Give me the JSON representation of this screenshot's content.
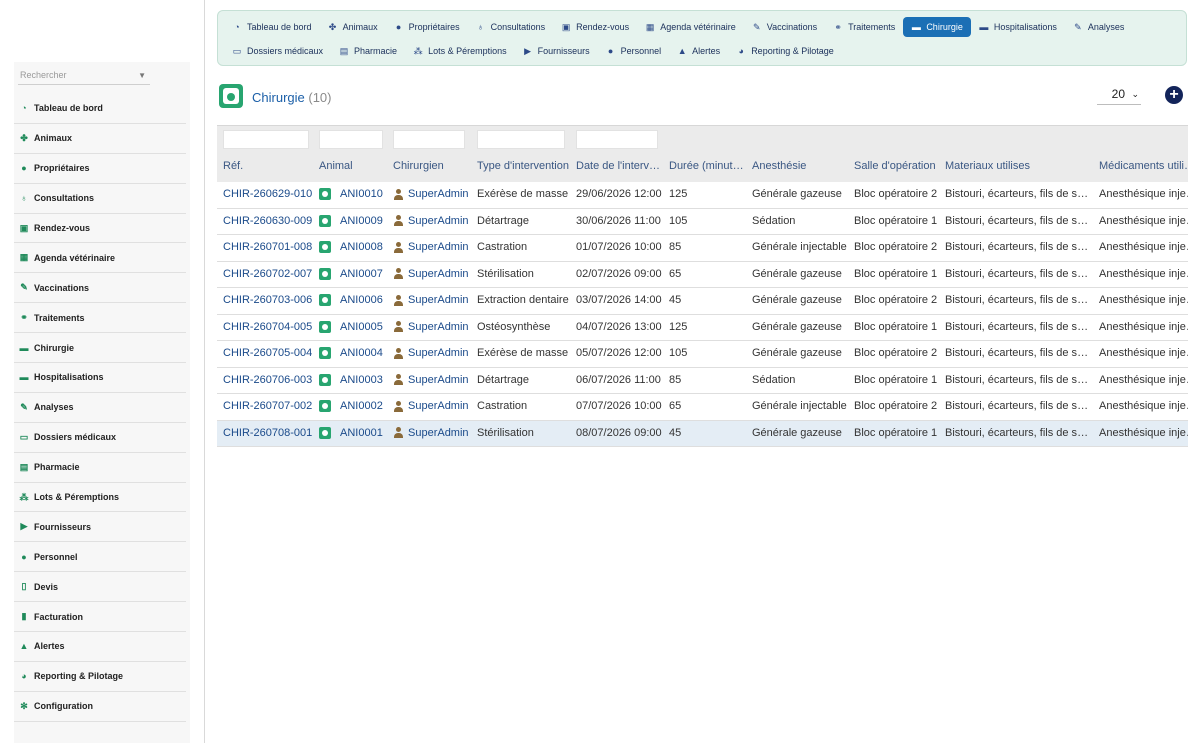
{
  "sidebar": {
    "search_placeholder": "Rechercher",
    "items": [
      {
        "label": "Tableau de bord",
        "icon": "dashboard-icon"
      },
      {
        "label": "Animaux",
        "icon": "paw-icon"
      },
      {
        "label": "Propriétaires",
        "icon": "user-icon"
      },
      {
        "label": "Consultations",
        "icon": "stethoscope-icon"
      },
      {
        "label": "Rendez-vous",
        "icon": "calendar-check-icon"
      },
      {
        "label": "Agenda vétérinaire",
        "icon": "calendar-icon"
      },
      {
        "label": "Vaccinations",
        "icon": "syringe-icon"
      },
      {
        "label": "Traitements",
        "icon": "pills-icon"
      },
      {
        "label": "Chirurgie",
        "icon": "bed-icon"
      },
      {
        "label": "Hospitalisations",
        "icon": "hospital-bed-icon"
      },
      {
        "label": "Analyses",
        "icon": "flask-icon"
      },
      {
        "label": "Dossiers médicaux",
        "icon": "folder-icon"
      },
      {
        "label": "Pharmacie",
        "icon": "medkit-icon"
      },
      {
        "label": "Lots & Péremptions",
        "icon": "sitemap-icon"
      },
      {
        "label": "Fournisseurs",
        "icon": "truck-icon"
      },
      {
        "label": "Personnel",
        "icon": "user-icon"
      },
      {
        "label": "Devis",
        "icon": "file-icon"
      },
      {
        "label": "Facturation",
        "icon": "invoice-icon"
      },
      {
        "label": "Alertes",
        "icon": "warning-icon"
      },
      {
        "label": "Reporting & Pilotage",
        "icon": "pie-chart-icon"
      },
      {
        "label": "Configuration",
        "icon": "gear-icon"
      }
    ]
  },
  "topnav": {
    "row1": [
      {
        "label": "Tableau de bord",
        "icon": "dashboard-icon"
      },
      {
        "label": "Animaux",
        "icon": "paw-icon"
      },
      {
        "label": "Propriétaires",
        "icon": "user-icon"
      },
      {
        "label": "Consultations",
        "icon": "stethoscope-icon"
      },
      {
        "label": "Rendez-vous",
        "icon": "calendar-check-icon"
      },
      {
        "label": "Agenda vétérinaire",
        "icon": "calendar-icon"
      },
      {
        "label": "Vaccinations",
        "icon": "syringe-icon"
      },
      {
        "label": "Traitements",
        "icon": "pills-icon"
      },
      {
        "label": "Chirurgie",
        "icon": "bed-icon",
        "active": true
      },
      {
        "label": "Hospitalisations",
        "icon": "hospital-bed-icon"
      },
      {
        "label": "Analyses",
        "icon": "flask-icon"
      }
    ],
    "row2": [
      {
        "label": "Dossiers médicaux",
        "icon": "folder-icon"
      },
      {
        "label": "Pharmacie",
        "icon": "medkit-icon"
      },
      {
        "label": "Lots & Péremptions",
        "icon": "sitemap-icon"
      },
      {
        "label": "Fournisseurs",
        "icon": "truck-icon"
      },
      {
        "label": "Personnel",
        "icon": "user-icon"
      },
      {
        "label": "Alertes",
        "icon": "warning-icon"
      },
      {
        "label": "Reporting & Pilotage",
        "icon": "pie-chart-icon"
      }
    ]
  },
  "page": {
    "title": "Chirurgie",
    "count": "(10)",
    "per_page": "20"
  },
  "table": {
    "headers": [
      "Réf.",
      "Animal",
      "Chirurgien",
      "Type d'intervention",
      "Date de l'intervention",
      "Durée (minutes)",
      "Anesthésie",
      "Salle d'opération",
      "Materiaux utilises",
      "Médicaments utilisés"
    ],
    "rows": [
      [
        "CHIR-260629-010",
        "ANI0010",
        "SuperAdmin",
        "Exérèse de masse",
        "29/06/2026 12:00",
        "125",
        "Générale gazeuse",
        "Bloc opératoire 2",
        "Bistouri, écarteurs, fils de suture",
        "Anesthésique injectable"
      ],
      [
        "CHIR-260630-009",
        "ANI0009",
        "SuperAdmin",
        "Détartrage",
        "30/06/2026 11:00",
        "105",
        "Sédation",
        "Bloc opératoire 1",
        "Bistouri, écarteurs, fils de suture",
        "Anesthésique injectable"
      ],
      [
        "CHIR-260701-008",
        "ANI0008",
        "SuperAdmin",
        "Castration",
        "01/07/2026 10:00",
        "85",
        "Générale injectable",
        "Bloc opératoire 2",
        "Bistouri, écarteurs, fils de suture",
        "Anesthésique injectable"
      ],
      [
        "CHIR-260702-007",
        "ANI0007",
        "SuperAdmin",
        "Stérilisation",
        "02/07/2026 09:00",
        "65",
        "Générale gazeuse",
        "Bloc opératoire 1",
        "Bistouri, écarteurs, fils de suture",
        "Anesthésique injectable"
      ],
      [
        "CHIR-260703-006",
        "ANI0006",
        "SuperAdmin",
        "Extraction dentaire",
        "03/07/2026 14:00",
        "45",
        "Générale gazeuse",
        "Bloc opératoire 2",
        "Bistouri, écarteurs, fils de suture",
        "Anesthésique injectable"
      ],
      [
        "CHIR-260704-005",
        "ANI0005",
        "SuperAdmin",
        "Ostéosynthèse",
        "04/07/2026 13:00",
        "125",
        "Générale gazeuse",
        "Bloc opératoire 1",
        "Bistouri, écarteurs, fils de suture",
        "Anesthésique injectable"
      ],
      [
        "CHIR-260705-004",
        "ANI0004",
        "SuperAdmin",
        "Exérèse de masse",
        "05/07/2026 12:00",
        "105",
        "Générale gazeuse",
        "Bloc opératoire 2",
        "Bistouri, écarteurs, fils de suture",
        "Anesthésique injectable"
      ],
      [
        "CHIR-260706-003",
        "ANI0003",
        "SuperAdmin",
        "Détartrage",
        "06/07/2026 11:00",
        "85",
        "Sédation",
        "Bloc opératoire 1",
        "Bistouri, écarteurs, fils de suture",
        "Anesthésique injectable"
      ],
      [
        "CHIR-260707-002",
        "ANI0002",
        "SuperAdmin",
        "Castration",
        "07/07/2026 10:00",
        "65",
        "Générale injectable",
        "Bloc opératoire 2",
        "Bistouri, écarteurs, fils de suture",
        "Anesthésique injectable"
      ],
      [
        "CHIR-260708-001",
        "ANI0001",
        "SuperAdmin",
        "Stérilisation",
        "08/07/2026 09:00",
        "45",
        "Générale gazeuse",
        "Bloc opératoire 1",
        "Bistouri, écarteurs, fils de suture",
        "Anesthésique injectable"
      ]
    ],
    "selected_row": 9
  },
  "colors": {
    "accent": "#1b6fb5",
    "brand_green": "#28a570",
    "link": "#1a4a8a",
    "nav_bg": "#e6f3ee"
  }
}
